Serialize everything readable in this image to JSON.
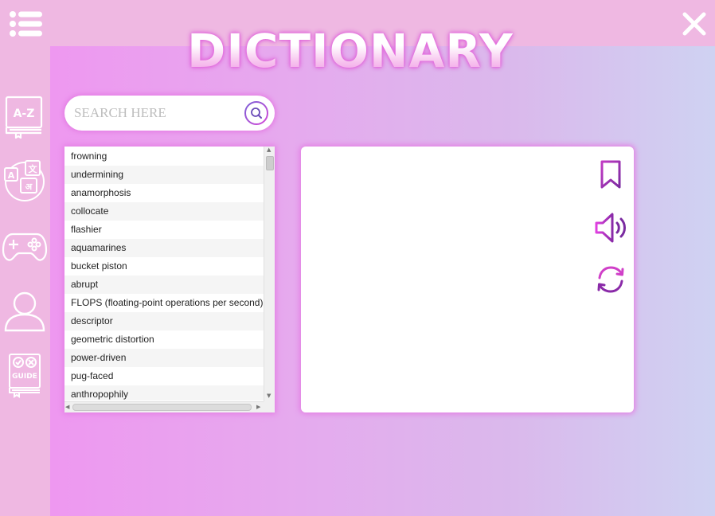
{
  "header": {
    "menu_icon": "hamburger-list-icon",
    "close_icon": "close-icon"
  },
  "sidebar": {
    "items": [
      {
        "name": "a-z-dictionary-icon",
        "label": "A-Z"
      },
      {
        "name": "translate-icon",
        "label": "A 文 अ"
      },
      {
        "name": "gamepad-icon"
      },
      {
        "name": "user-profile-icon"
      },
      {
        "name": "guide-book-icon",
        "label": "GUIDE"
      }
    ]
  },
  "main": {
    "title": "DICTIONARY",
    "search": {
      "placeholder": "SEARCH HERE",
      "value": "",
      "icon": "search-icon"
    },
    "word_list": [
      "frowning",
      "undermining",
      "anamorphosis",
      "collocate",
      "flashier",
      "aquamarines",
      "bucket piston",
      "abrupt",
      "FLOPS (floating-point operations per second)",
      "descriptor",
      "geometric distortion",
      "power-driven",
      "pug-faced",
      "anthropophily"
    ],
    "definition": {
      "text": "",
      "tools": [
        "bookmark-icon",
        "speaker-icon",
        "refresh-icon"
      ]
    }
  },
  "colors": {
    "sidebar_bg": "#efb8e2",
    "gradient_start": "#ee98f0",
    "gradient_end": "#cfd2f2",
    "glow": "#e47fe4",
    "tool_purple": "#9b2bb0",
    "tool_magenta": "#d63ad8"
  }
}
